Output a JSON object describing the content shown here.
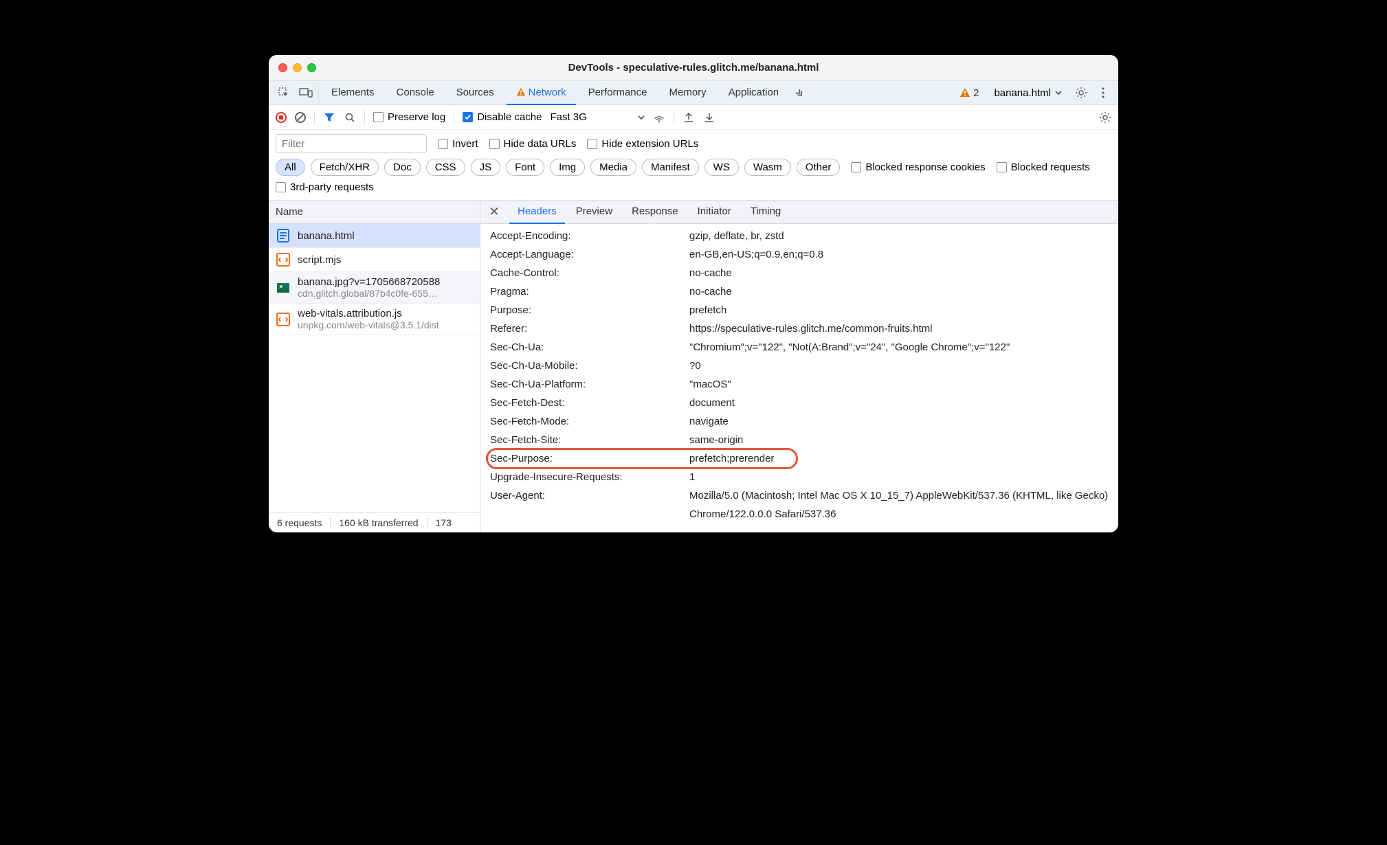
{
  "window": {
    "title": "DevTools - speculative-rules.glitch.me/banana.html"
  },
  "tabs": {
    "items": [
      "Elements",
      "Console",
      "Sources",
      "Network",
      "Performance",
      "Memory",
      "Application"
    ],
    "active": "Network",
    "warning_count": "2",
    "context_label": "banana.html"
  },
  "toolbar": {
    "preserve_log": "Preserve log",
    "disable_cache": "Disable cache",
    "throttle": "Fast 3G"
  },
  "filters": {
    "filter_placeholder": "Filter",
    "invert": "Invert",
    "hide_data": "Hide data URLs",
    "hide_ext": "Hide extension URLs",
    "types": [
      "All",
      "Fetch/XHR",
      "Doc",
      "CSS",
      "JS",
      "Font",
      "Img",
      "Media",
      "Manifest",
      "WS",
      "Wasm",
      "Other"
    ],
    "blocked_cookies": "Blocked response cookies",
    "blocked_requests": "Blocked requests",
    "third_party": "3rd-party requests"
  },
  "list": {
    "header": "Name",
    "rows": [
      {
        "name": "banana.html",
        "sub": "",
        "type": "doc"
      },
      {
        "name": "script.mjs",
        "sub": "",
        "type": "js"
      },
      {
        "name": "banana.jpg?v=1705668720588",
        "sub": "cdn.glitch.global/87b4c0fe-655…",
        "type": "img"
      },
      {
        "name": "web-vitals.attribution.js",
        "sub": "unpkg.com/web-vitals@3.5.1/dist",
        "type": "js"
      }
    ]
  },
  "detail_tabs": {
    "items": [
      "Headers",
      "Preview",
      "Response",
      "Initiator",
      "Timing"
    ],
    "active": "Headers"
  },
  "headers": [
    {
      "k": "Accept-Encoding:",
      "v": "gzip, deflate, br, zstd"
    },
    {
      "k": "Accept-Language:",
      "v": "en-GB,en-US;q=0.9,en;q=0.8"
    },
    {
      "k": "Cache-Control:",
      "v": "no-cache"
    },
    {
      "k": "Pragma:",
      "v": "no-cache"
    },
    {
      "k": "Purpose:",
      "v": "prefetch"
    },
    {
      "k": "Referer:",
      "v": "https://speculative-rules.glitch.me/common-fruits.html"
    },
    {
      "k": "Sec-Ch-Ua:",
      "v": "\"Chromium\";v=\"122\", \"Not(A:Brand\";v=\"24\", \"Google Chrome\";v=\"122\""
    },
    {
      "k": "Sec-Ch-Ua-Mobile:",
      "v": "?0"
    },
    {
      "k": "Sec-Ch-Ua-Platform:",
      "v": "\"macOS\""
    },
    {
      "k": "Sec-Fetch-Dest:",
      "v": "document"
    },
    {
      "k": "Sec-Fetch-Mode:",
      "v": "navigate"
    },
    {
      "k": "Sec-Fetch-Site:",
      "v": "same-origin"
    },
    {
      "k": "Sec-Purpose:",
      "v": "prefetch;prerender",
      "highlight": true
    },
    {
      "k": "Upgrade-Insecure-Requests:",
      "v": "1"
    },
    {
      "k": "User-Agent:",
      "v": "Mozilla/5.0 (Macintosh; Intel Mac OS X 10_15_7) AppleWebKit/537.36 (KHTML, like Gecko) Chrome/122.0.0.0 Safari/537.36"
    }
  ],
  "status": {
    "requests": "6 requests",
    "transferred": "160 kB transferred",
    "resources": "173"
  }
}
